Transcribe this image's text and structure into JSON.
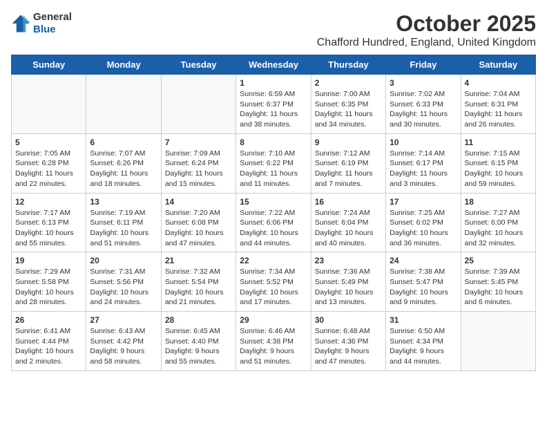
{
  "header": {
    "logo": {
      "general": "General",
      "blue": "Blue"
    },
    "title": "October 2025",
    "location": "Chafford Hundred, England, United Kingdom"
  },
  "days_of_week": [
    "Sunday",
    "Monday",
    "Tuesday",
    "Wednesday",
    "Thursday",
    "Friday",
    "Saturday"
  ],
  "weeks": [
    [
      {
        "day": "",
        "info": ""
      },
      {
        "day": "",
        "info": ""
      },
      {
        "day": "",
        "info": ""
      },
      {
        "day": "1",
        "info": "Sunrise: 6:59 AM\nSunset: 6:37 PM\nDaylight: 11 hours and 38 minutes."
      },
      {
        "day": "2",
        "info": "Sunrise: 7:00 AM\nSunset: 6:35 PM\nDaylight: 11 hours and 34 minutes."
      },
      {
        "day": "3",
        "info": "Sunrise: 7:02 AM\nSunset: 6:33 PM\nDaylight: 11 hours and 30 minutes."
      },
      {
        "day": "4",
        "info": "Sunrise: 7:04 AM\nSunset: 6:31 PM\nDaylight: 11 hours and 26 minutes."
      }
    ],
    [
      {
        "day": "5",
        "info": "Sunrise: 7:05 AM\nSunset: 6:28 PM\nDaylight: 11 hours and 22 minutes."
      },
      {
        "day": "6",
        "info": "Sunrise: 7:07 AM\nSunset: 6:26 PM\nDaylight: 11 hours and 18 minutes."
      },
      {
        "day": "7",
        "info": "Sunrise: 7:09 AM\nSunset: 6:24 PM\nDaylight: 11 hours and 15 minutes."
      },
      {
        "day": "8",
        "info": "Sunrise: 7:10 AM\nSunset: 6:22 PM\nDaylight: 11 hours and 11 minutes."
      },
      {
        "day": "9",
        "info": "Sunrise: 7:12 AM\nSunset: 6:19 PM\nDaylight: 11 hours and 7 minutes."
      },
      {
        "day": "10",
        "info": "Sunrise: 7:14 AM\nSunset: 6:17 PM\nDaylight: 11 hours and 3 minutes."
      },
      {
        "day": "11",
        "info": "Sunrise: 7:15 AM\nSunset: 6:15 PM\nDaylight: 10 hours and 59 minutes."
      }
    ],
    [
      {
        "day": "12",
        "info": "Sunrise: 7:17 AM\nSunset: 6:13 PM\nDaylight: 10 hours and 55 minutes."
      },
      {
        "day": "13",
        "info": "Sunrise: 7:19 AM\nSunset: 6:11 PM\nDaylight: 10 hours and 51 minutes."
      },
      {
        "day": "14",
        "info": "Sunrise: 7:20 AM\nSunset: 6:08 PM\nDaylight: 10 hours and 47 minutes."
      },
      {
        "day": "15",
        "info": "Sunrise: 7:22 AM\nSunset: 6:06 PM\nDaylight: 10 hours and 44 minutes."
      },
      {
        "day": "16",
        "info": "Sunrise: 7:24 AM\nSunset: 6:04 PM\nDaylight: 10 hours and 40 minutes."
      },
      {
        "day": "17",
        "info": "Sunrise: 7:25 AM\nSunset: 6:02 PM\nDaylight: 10 hours and 36 minutes."
      },
      {
        "day": "18",
        "info": "Sunrise: 7:27 AM\nSunset: 6:00 PM\nDaylight: 10 hours and 32 minutes."
      }
    ],
    [
      {
        "day": "19",
        "info": "Sunrise: 7:29 AM\nSunset: 5:58 PM\nDaylight: 10 hours and 28 minutes."
      },
      {
        "day": "20",
        "info": "Sunrise: 7:31 AM\nSunset: 5:56 PM\nDaylight: 10 hours and 24 minutes."
      },
      {
        "day": "21",
        "info": "Sunrise: 7:32 AM\nSunset: 5:54 PM\nDaylight: 10 hours and 21 minutes."
      },
      {
        "day": "22",
        "info": "Sunrise: 7:34 AM\nSunset: 5:52 PM\nDaylight: 10 hours and 17 minutes."
      },
      {
        "day": "23",
        "info": "Sunrise: 7:36 AM\nSunset: 5:49 PM\nDaylight: 10 hours and 13 minutes."
      },
      {
        "day": "24",
        "info": "Sunrise: 7:38 AM\nSunset: 5:47 PM\nDaylight: 10 hours and 9 minutes."
      },
      {
        "day": "25",
        "info": "Sunrise: 7:39 AM\nSunset: 5:45 PM\nDaylight: 10 hours and 6 minutes."
      }
    ],
    [
      {
        "day": "26",
        "info": "Sunrise: 6:41 AM\nSunset: 4:44 PM\nDaylight: 10 hours and 2 minutes."
      },
      {
        "day": "27",
        "info": "Sunrise: 6:43 AM\nSunset: 4:42 PM\nDaylight: 9 hours and 58 minutes."
      },
      {
        "day": "28",
        "info": "Sunrise: 6:45 AM\nSunset: 4:40 PM\nDaylight: 9 hours and 55 minutes."
      },
      {
        "day": "29",
        "info": "Sunrise: 6:46 AM\nSunset: 4:38 PM\nDaylight: 9 hours and 51 minutes."
      },
      {
        "day": "30",
        "info": "Sunrise: 6:48 AM\nSunset: 4:36 PM\nDaylight: 9 hours and 47 minutes."
      },
      {
        "day": "31",
        "info": "Sunrise: 6:50 AM\nSunset: 4:34 PM\nDaylight: 9 hours and 44 minutes."
      },
      {
        "day": "",
        "info": ""
      }
    ]
  ]
}
